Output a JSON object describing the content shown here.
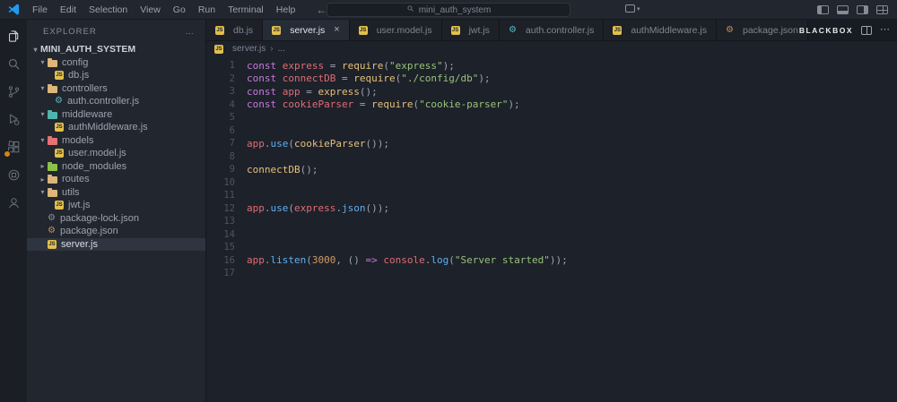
{
  "titlebar": {
    "menus": [
      "File",
      "Edit",
      "Selection",
      "View",
      "Go",
      "Run",
      "Terminal",
      "Help"
    ],
    "search": {
      "value": "mini_auth_system"
    },
    "window_icons": [
      "toggle-primary-sidebar",
      "toggle-panel",
      "toggle-secondary-sidebar",
      "customize-layout"
    ]
  },
  "activitybar": {
    "items": [
      {
        "name": "explorer",
        "active": true
      },
      {
        "name": "search"
      },
      {
        "name": "source-control"
      },
      {
        "name": "run-and-debug"
      },
      {
        "name": "extensions",
        "badge": true
      },
      {
        "name": "blackbox"
      },
      {
        "name": "account"
      }
    ]
  },
  "sidebar": {
    "header": {
      "title": "EXPLORER",
      "more": "…"
    },
    "items": [
      {
        "label": "MINI_AUTH_SYSTEM",
        "type": "root",
        "level": 0,
        "expanded": true
      },
      {
        "label": "config",
        "type": "folder",
        "level": 1,
        "expanded": true,
        "color": "#dcb67a"
      },
      {
        "label": "db.js",
        "type": "js",
        "level": 2
      },
      {
        "label": "controllers",
        "type": "folder",
        "level": 1,
        "expanded": true,
        "color": "#dcb67a"
      },
      {
        "label": "auth.controller.js",
        "type": "gear",
        "level": 2,
        "color": "#56b6c2"
      },
      {
        "label": "middleware",
        "type": "folder",
        "level": 1,
        "expanded": true,
        "color": "#4db6ac"
      },
      {
        "label": "authMiddleware.js",
        "type": "js",
        "level": 2
      },
      {
        "label": "models",
        "type": "folder",
        "level": 1,
        "expanded": true,
        "color": "#e57373"
      },
      {
        "label": "user.model.js",
        "type": "js",
        "level": 2
      },
      {
        "label": "node_modules",
        "type": "folder",
        "level": 1,
        "expanded": false,
        "color": "#8bc34a"
      },
      {
        "label": "routes",
        "type": "folder",
        "level": 1,
        "expanded": false,
        "color": "#dcb67a"
      },
      {
        "label": "utils",
        "type": "folder",
        "level": 1,
        "expanded": true,
        "color": "#dcb67a"
      },
      {
        "label": "jwt.js",
        "type": "js",
        "level": 2
      },
      {
        "label": "package-lock.json",
        "type": "gear",
        "level": 1,
        "color": "#8a919d"
      },
      {
        "label": "package.json",
        "type": "gear",
        "level": 1,
        "color": "#c08d5f"
      },
      {
        "label": "server.js",
        "type": "js",
        "level": 1,
        "selected": true
      }
    ]
  },
  "tabstrip": {
    "brand": "BLACKBOX",
    "tabs": [
      {
        "label": "db.js",
        "icon": "js"
      },
      {
        "label": "server.js",
        "icon": "js",
        "active": true,
        "close": "×"
      },
      {
        "label": "user.model.js",
        "icon": "js"
      },
      {
        "label": "jwt.js",
        "icon": "js"
      },
      {
        "label": "auth.controller.js",
        "icon": "gear",
        "color": "#56b6c2"
      },
      {
        "label": "authMiddleware.js",
        "icon": "js"
      },
      {
        "label": "package.json",
        "icon": "gear",
        "color": "#c08d5f"
      }
    ]
  },
  "breadcrumb": {
    "file": "server.js",
    "more": "..."
  },
  "editor": {
    "start_line": 1,
    "lines": [
      [
        [
          "k",
          "const"
        ],
        [
          "p",
          " "
        ],
        [
          "v",
          "express"
        ],
        [
          "p",
          " = "
        ],
        [
          "f",
          "require"
        ],
        [
          "p",
          "("
        ],
        [
          "s",
          "\"express\""
        ],
        [
          "p",
          ");"
        ]
      ],
      [
        [
          "k",
          "const"
        ],
        [
          "p",
          " "
        ],
        [
          "v",
          "connectDB"
        ],
        [
          "p",
          " = "
        ],
        [
          "f",
          "require"
        ],
        [
          "p",
          "("
        ],
        [
          "s",
          "\"./config/db\""
        ],
        [
          "p",
          ");"
        ]
      ],
      [
        [
          "k",
          "const"
        ],
        [
          "p",
          " "
        ],
        [
          "v",
          "app"
        ],
        [
          "p",
          " = "
        ],
        [
          "f",
          "express"
        ],
        [
          "p",
          "();"
        ]
      ],
      [
        [
          "k",
          "const"
        ],
        [
          "p",
          " "
        ],
        [
          "v",
          "cookieParser"
        ],
        [
          "p",
          " = "
        ],
        [
          "f",
          "require"
        ],
        [
          "p",
          "("
        ],
        [
          "s",
          "\"cookie-parser\""
        ],
        [
          "p",
          ");"
        ]
      ],
      [],
      [],
      [
        [
          "v",
          "app"
        ],
        [
          "p",
          "."
        ],
        [
          "m",
          "use"
        ],
        [
          "p",
          "("
        ],
        [
          "f",
          "cookieParser"
        ],
        [
          "p",
          "());"
        ]
      ],
      [],
      [
        [
          "f",
          "connectDB"
        ],
        [
          "p",
          "();"
        ]
      ],
      [],
      [],
      [
        [
          "v",
          "app"
        ],
        [
          "p",
          "."
        ],
        [
          "m",
          "use"
        ],
        [
          "p",
          "("
        ],
        [
          "v",
          "express"
        ],
        [
          "p",
          "."
        ],
        [
          "m",
          "json"
        ],
        [
          "p",
          "());"
        ]
      ],
      [],
      [],
      [],
      [
        [
          "v",
          "app"
        ],
        [
          "p",
          "."
        ],
        [
          "m",
          "listen"
        ],
        [
          "p",
          "("
        ],
        [
          "n",
          "3000"
        ],
        [
          "p",
          ", () "
        ],
        [
          "k",
          "=>"
        ],
        [
          "p",
          " "
        ],
        [
          "v",
          "console"
        ],
        [
          "p",
          "."
        ],
        [
          "m",
          "log"
        ],
        [
          "p",
          "("
        ],
        [
          "s",
          "\"Server started\""
        ],
        [
          "p",
          "));"
        ]
      ],
      []
    ]
  }
}
